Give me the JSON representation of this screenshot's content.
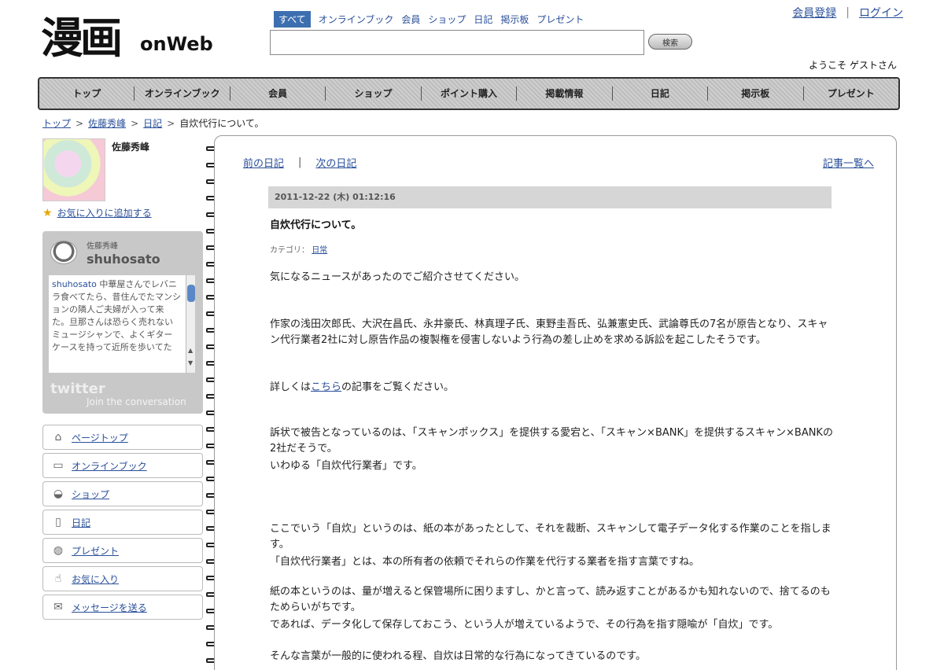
{
  "header": {
    "logo_kanji": "漫画",
    "logo_latin": "onWeb",
    "search_tabs": [
      "すべて",
      "オンラインブック",
      "会員",
      "ショップ",
      "日記",
      "掲示板",
      "プレゼント"
    ],
    "search_placeholder": "",
    "search_button": "検索",
    "account": {
      "register": "会員登録",
      "separator": "|",
      "login": "ログイン"
    },
    "welcome": "ようこそ ゲストさん"
  },
  "global_nav": [
    "トップ",
    "オンラインブック",
    "会員",
    "ショップ",
    "ポイント購入",
    "掲載情報",
    "日記",
    "掲示板",
    "プレゼント"
  ],
  "breadcrumb": {
    "items": [
      "トップ",
      "佐藤秀峰",
      "日記"
    ],
    "separator": ">",
    "current": "自炊代行について。"
  },
  "profile": {
    "name": "佐藤秀峰",
    "fav_notify": "お気に入りに追加する"
  },
  "twitter": {
    "real_name": "佐藤秀峰",
    "handle": "shuhosato",
    "feed_handle": "shuhosato",
    "feed_text": "中華屋さんでレバニラ食べてたら、昔住んでたマンションの隣人ご夫婦が入って来た。旦那さんは恐らく売れないミュージシャンで、よくギターケースを持って近所を歩いてた",
    "brand": "twitter",
    "join": "Join the conversation"
  },
  "side_menu": [
    {
      "label": "ページトップ",
      "icon": "home-icon"
    },
    {
      "label": "オンラインブック",
      "icon": "book-icon"
    },
    {
      "label": "ショップ",
      "icon": "shop-basket-icon"
    },
    {
      "label": "日記",
      "icon": "pen-icon"
    },
    {
      "label": "プレゼント",
      "icon": "gift-icon"
    },
    {
      "label": "お気に入り",
      "icon": "favorite-icon"
    },
    {
      "label": "メッセージを送る",
      "icon": "mail-icon"
    }
  ],
  "article": {
    "prev": "前の日記",
    "separator": "|",
    "next": "次の日記",
    "list": "記事一覧へ",
    "date": "2011-12-22 (木) 01:12:16",
    "title": "自炊代行について。",
    "category_label": "カテゴリ：",
    "category_value": "日常",
    "p1": "気になるニュースがあったのでご紹介させてください。",
    "p2": "作家の浅田次郎氏、大沢在昌氏、永井豪氏、林真理子氏、東野圭吾氏、弘兼憲史氏、武論尊氏の7名が原告となり、スキャン代行業者2社に対し原告作品の複製権を侵害しないよう行為の差し止めを求める訴訟を起こしたそうです。",
    "p3_pre": "詳しくは",
    "p3_link": "こちら",
    "p3_post": "の記事をご覧ください。",
    "p4": "訴状で被告となっているのは、「スキャンポックス」を提供する愛宕と、「スキャン×BANK」を提供するスキャン×BANKの2社だそうで。",
    "p5": "いわゆる「自炊代行業者」です。",
    "p6": "ここでいう「自炊」というのは、紙の本があったとして、それを裁断、スキャンして電子データ化する作業のことを指します。",
    "p7": "「自炊代行業者」とは、本の所有者の依頼でそれらの作業を代行する業者を指す言葉ですね。",
    "p8": "紙の本というのは、量が増えると保管場所に困りますし、かと言って、読み返すことがあるかも知れないので、捨てるのもためらいがちです。",
    "p9": "であれば、データ化して保存しておこう、という人が増えているようで、その行為を指す隠喩が「自炊」です。",
    "p10": "そんな言葉が一般的に使われる程、自炊は日常的な行為になってきているのです。"
  }
}
